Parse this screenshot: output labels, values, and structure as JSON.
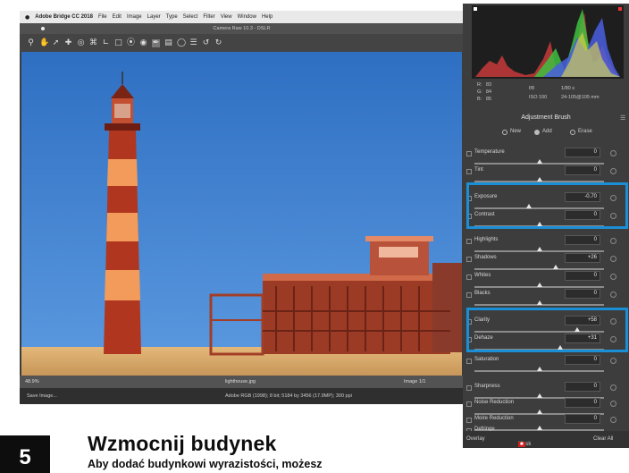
{
  "app": {
    "menu": [
      "Adobe Bridge CC 2018",
      "File",
      "Edit",
      "Image",
      "Layer",
      "Type",
      "Select",
      "Filter",
      "View",
      "Window",
      "Help"
    ],
    "window_title": "Camera Raw 10.3 - DSLR",
    "status_zoom": "48.9%",
    "status_file": "lighthouse.jpg",
    "status_right": "Image 1/1",
    "bottom_left": "Save Image...",
    "bottom_center": "Adobe RGB (1998); 8 bit; 5184 by 3456 (17.9MP); 300 ppi"
  },
  "panel": {
    "rgb": {
      "r": "R:",
      "g": "G:",
      "b": "B:",
      "r_val": "83",
      "g_val": "84",
      "b_val": "85"
    },
    "camera": {
      "iso": "ISO 100",
      "lens": "24-105@105 mm",
      "exposure": "1/80 s",
      "aperture": "f/8"
    },
    "title": "Adjustment Brush",
    "modes": {
      "new": "New",
      "add": "Add",
      "erase": "Erase"
    },
    "sliders": [
      {
        "label": "Temperature",
        "value": "0",
        "pos": 0.5
      },
      {
        "label": "Tint",
        "value": "0",
        "pos": 0.5
      },
      {
        "label": "Exposure",
        "value": "-0.70",
        "pos": 0.42
      },
      {
        "label": "Contrast",
        "value": "0",
        "pos": 0.5
      },
      {
        "label": "Highlights",
        "value": "0",
        "pos": 0.5
      },
      {
        "label": "Shadows",
        "value": "+26",
        "pos": 0.63
      },
      {
        "label": "Whites",
        "value": "0",
        "pos": 0.5
      },
      {
        "label": "Blacks",
        "value": "0",
        "pos": 0.5
      },
      {
        "label": "Clarity",
        "value": "+58",
        "pos": 0.79
      },
      {
        "label": "Dehaze",
        "value": "+31",
        "pos": 0.66
      },
      {
        "label": "Saturation",
        "value": "0",
        "pos": 0.5
      },
      {
        "label": "Sharpness",
        "value": "0",
        "pos": 0.5
      },
      {
        "label": "Noise Reduction",
        "value": "0",
        "pos": 0.5
      },
      {
        "label": "Moire Reduction",
        "value": "0",
        "pos": 0.5
      },
      {
        "label": "Defringe",
        "value": "0",
        "pos": 0.5
      }
    ],
    "footer": {
      "overlay": "Overlay",
      "mask": "Mask",
      "clear": "Clear All"
    }
  },
  "magazine": {
    "step": "5",
    "heading": "Wzmocnij budynek",
    "subtext": "Aby dodać budynkowi wyrazistości, możesz"
  },
  "colors": {
    "highlight": "#1b8fd6"
  }
}
